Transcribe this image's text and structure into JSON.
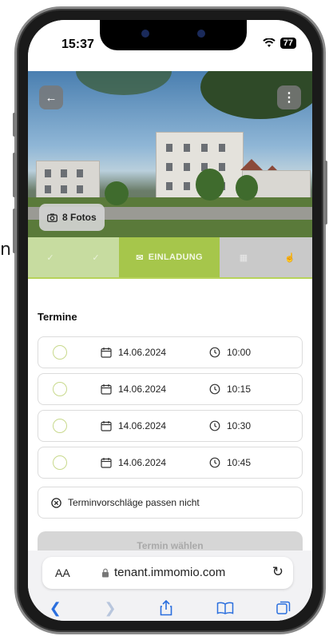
{
  "status": {
    "time": "15:37",
    "battery": "77"
  },
  "hero": {
    "photos_label": "8 Fotos"
  },
  "steps": [
    {
      "label": "",
      "state": "done",
      "icon": "check-icon"
    },
    {
      "label": "",
      "state": "done",
      "icon": "check-icon"
    },
    {
      "label": "EINLADUNG",
      "state": "active",
      "icon": "mail-icon"
    },
    {
      "label": "",
      "state": "inactive",
      "icon": "calendar-icon"
    },
    {
      "label": "",
      "state": "inactive",
      "icon": "thumbs-up-icon"
    }
  ],
  "appointments": {
    "title": "Termine",
    "slots": [
      {
        "date": "14.06.2024",
        "time": "10:00"
      },
      {
        "date": "14.06.2024",
        "time": "10:15"
      },
      {
        "date": "14.06.2024",
        "time": "10:30"
      },
      {
        "date": "14.06.2024",
        "time": "10:45"
      }
    ],
    "decline_label": "Terminvorschläge passen nicht",
    "submit_label": "Termin wählen"
  },
  "browser": {
    "aa_label": "AA",
    "url": "tenant.immomio.com"
  },
  "colors": {
    "accent_green": "#a6c64b",
    "step_done": "#c7dca0",
    "step_inactive": "#c9c9c9",
    "link_blue": "#2b6fde"
  }
}
